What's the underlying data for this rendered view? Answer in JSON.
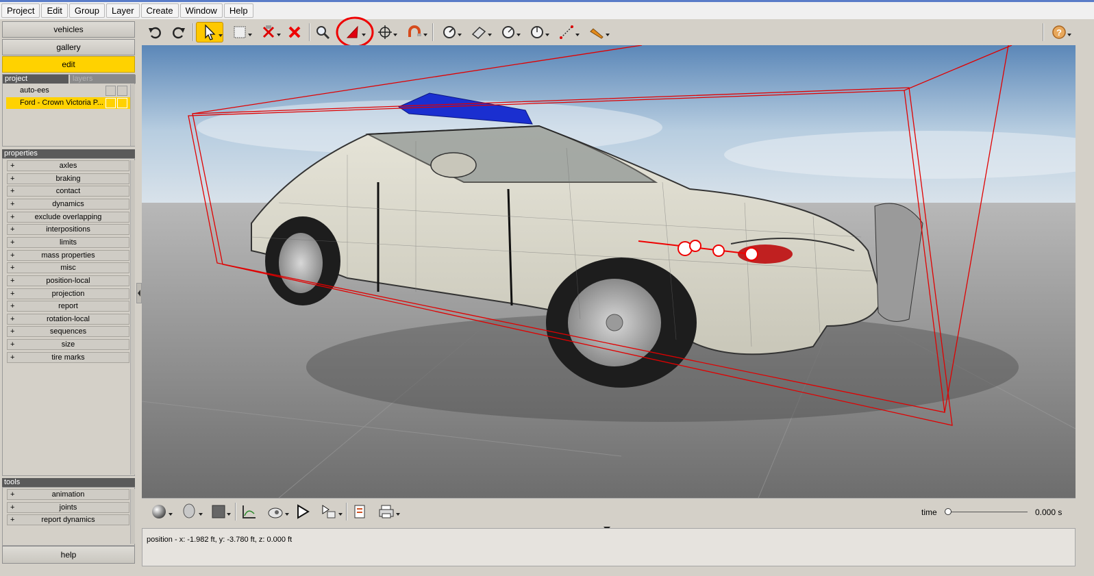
{
  "menu": [
    "Project",
    "Edit",
    "Group",
    "Layer",
    "Create",
    "Window",
    "Help"
  ],
  "nav": {
    "vehicles": "vehicles",
    "gallery": "gallery",
    "edit": "edit"
  },
  "project_section": {
    "tab_project": "project",
    "tab_layers": "layers",
    "items": [
      "auto-ees",
      "Ford - Crown Victoria P..."
    ]
  },
  "properties": {
    "header": "properties",
    "items": [
      "axles",
      "braking",
      "contact",
      "dynamics",
      "exclude overlapping",
      "interpositions",
      "limits",
      "mass properties",
      "misc",
      "position-local",
      "projection",
      "report",
      "rotation-local",
      "sequences",
      "size",
      "tire marks"
    ]
  },
  "tools": {
    "header": "tools",
    "items": [
      "animation",
      "joints",
      "report dynamics"
    ]
  },
  "help_label": "help",
  "toolbar_icons": [
    "undo-icon",
    "redo-icon",
    "select-arrow-icon",
    "rectangle-select-icon",
    "explode-icon",
    "delete-icon",
    "zoom-icon",
    "marker-icon",
    "move-icon",
    "magnet-icon",
    "gauge-icon",
    "ruler-surface-icon",
    "angle-gauge-icon",
    "dial-icon",
    "measure-icon",
    "pencil-icon",
    "help-icon"
  ],
  "bottom_icons": [
    "sphere-icon",
    "head-icon",
    "color-square-icon",
    "graph-icon",
    "camera-icon",
    "play-icon",
    "play-list-icon",
    "report-icon",
    "print-icon"
  ],
  "time": {
    "label": "time",
    "value": "0.000 s",
    "position": 0.0
  },
  "status": {
    "text": "position - x: -1.982 ft, y: -3.780 ft, z: 0.000 ft"
  },
  "colors": {
    "accent": "#ffd200",
    "selection_red": "#e00000",
    "beacon_blue": "#1a2fd0"
  }
}
